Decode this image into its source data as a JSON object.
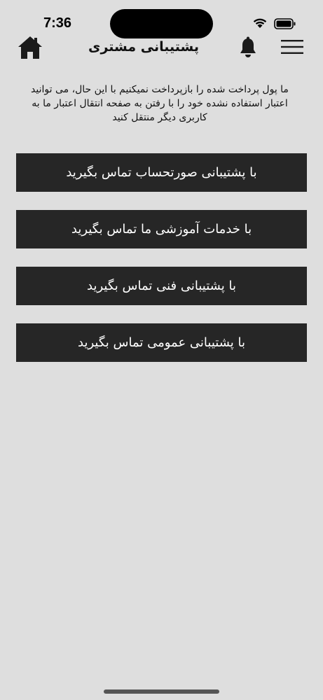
{
  "status_bar": {
    "time": "7:36",
    "icons": [
      "wifi-icon",
      "battery-icon"
    ]
  },
  "header": {
    "title": "پشتیبانی مشتری",
    "icons": [
      "home-icon",
      "bell-icon",
      "menu-icon"
    ]
  },
  "description": "ما پول پرداخت شده را بازپرداخت نمیکنیم با این حال، می توانید اعتبار استفاده نشده خود را با رفتن به صفحه انتقال اعتبار ما به کاربری دیگر منتقل کنید",
  "buttons": [
    {
      "label": "با پشتیبانی صورتحساب تماس بگیرید"
    },
    {
      "label": "با خدمات آموزشی ما تماس بگیرید"
    },
    {
      "label": "با پشتیبانی فنی تماس بگیرید"
    },
    {
      "label": "با پشتیبانی عمومی تماس بگیرید"
    }
  ],
  "colors": {
    "background": "#dedede",
    "button_background": "#262626",
    "button_text": "#ffffff"
  }
}
